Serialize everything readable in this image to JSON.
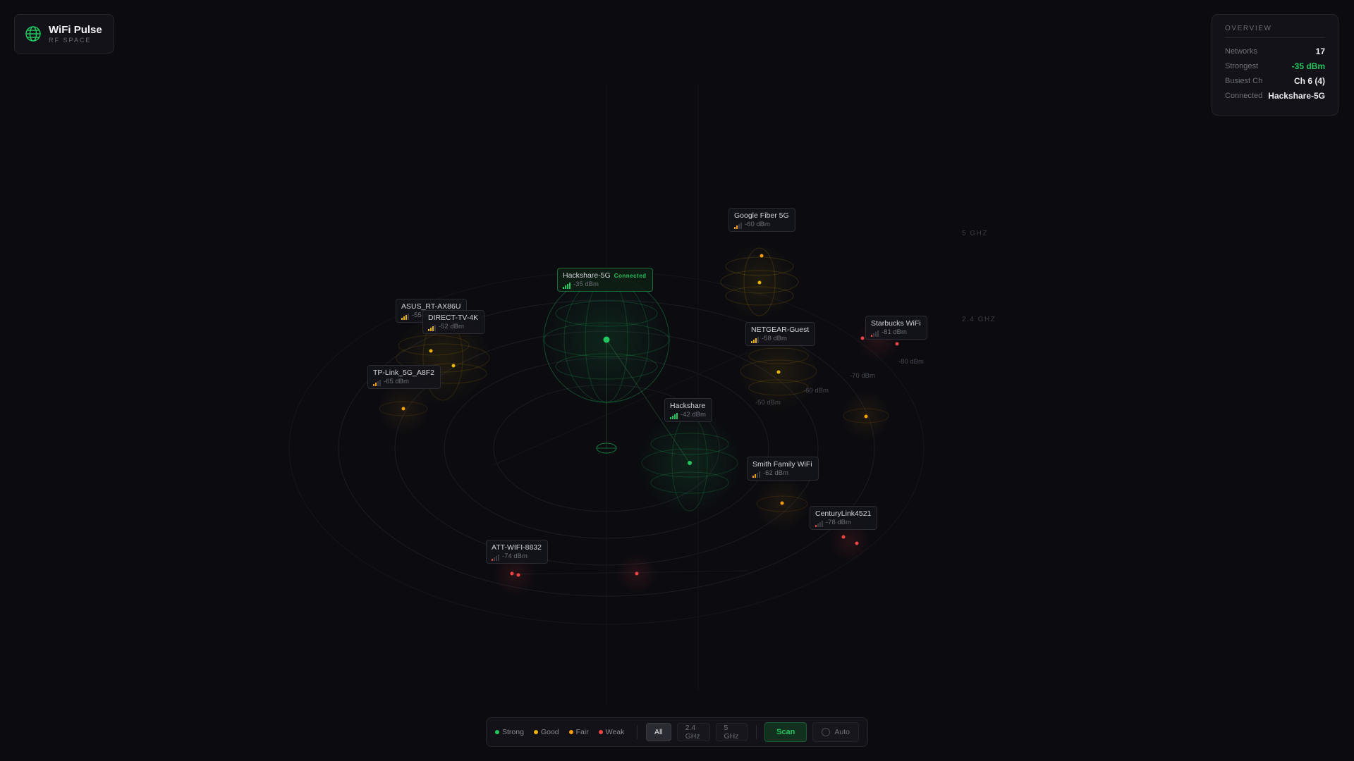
{
  "app": {
    "title": "WiFi Pulse",
    "subtitle": "RF SPACE"
  },
  "overview": {
    "title": "OVERVIEW",
    "rows": [
      {
        "key": "Networks",
        "value": "17"
      },
      {
        "key": "Strongest",
        "value": "-35 dBm"
      },
      {
        "key": "Busiest Ch",
        "value": "Ch 6 (4)"
      },
      {
        "key": "Connected",
        "value": "Hackshare-5G"
      }
    ]
  },
  "colors": {
    "strong": "#22c55e",
    "good": "#eab308",
    "fair": "#f59e0b",
    "weak": "#ef4444",
    "background": "#0b0b10",
    "accent": "#22c55e"
  },
  "networks": [
    {
      "name": "Hackshare-5G",
      "signal": "-35 dBm",
      "level": "strong",
      "bars": 4,
      "connected": true,
      "badge": "Connected"
    },
    {
      "name": "Hackshare",
      "signal": "-42 dBm",
      "level": "strong",
      "bars": 4
    },
    {
      "name": "Google Fiber 5G",
      "signal": "-60 dBm",
      "level": "fair",
      "bars": 2
    },
    {
      "name": "NETGEAR-Guest",
      "signal": "-58 dBm",
      "level": "good",
      "bars": 3
    },
    {
      "name": "ASUS_RT-AX86U",
      "signal": "-55 dBm",
      "level": "good",
      "bars": 3
    },
    {
      "name": "DIRECT-TV-4K",
      "signal": "-52 dBm",
      "level": "good",
      "bars": 3
    },
    {
      "name": "TP-Link_5G_A8F2",
      "signal": "-65 dBm",
      "level": "fair",
      "bars": 2
    },
    {
      "name": "Starbucks WiFi",
      "signal": "-81 dBm",
      "level": "weak",
      "bars": 1
    },
    {
      "name": "Smith Family WiFi",
      "signal": "-62 dBm",
      "level": "fair",
      "bars": 2
    },
    {
      "name": "CenturyLink4521",
      "signal": "-78 dBm",
      "level": "weak",
      "bars": 1
    },
    {
      "name": "ATT-WIFI-8832",
      "signal": "-74 dBm",
      "level": "weak",
      "bars": 1
    }
  ],
  "rings": [
    "-50 dBm",
    "-60 dBm",
    "-70 dBm",
    "-80 dBm"
  ],
  "bands": [
    "5 GHZ",
    "2.4 GHZ"
  ],
  "legend": [
    {
      "label": "Strong",
      "color": "#22c55e"
    },
    {
      "label": "Good",
      "color": "#eab308"
    },
    {
      "label": "Fair",
      "color": "#f59e0b"
    },
    {
      "label": "Weak",
      "color": "#ef4444"
    }
  ],
  "filters": [
    "All",
    "2.4 GHz",
    "5 GHz"
  ],
  "activeFilter": "All",
  "actions": {
    "scan": "Scan",
    "auto": "Auto"
  }
}
